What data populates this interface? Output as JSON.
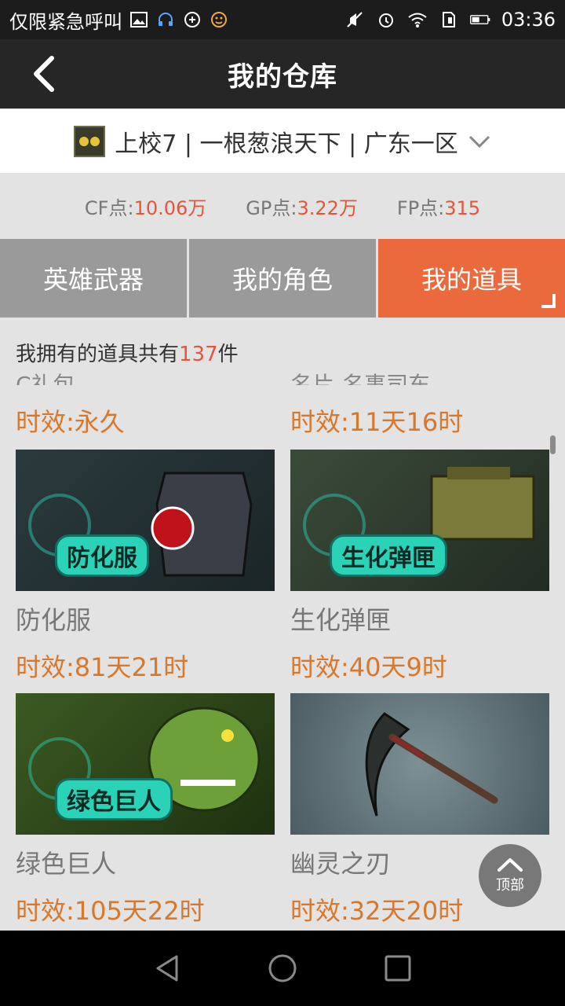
{
  "status_bar": {
    "carrier": "仅限紧急呼叫",
    "time": "03:36",
    "icons": [
      "image-icon",
      "headset-icon",
      "sync-icon",
      "emoji-icon",
      "mute-icon",
      "alarm-icon",
      "wifi-icon",
      "sim-icon",
      "battery-icon"
    ]
  },
  "header": {
    "title": "我的仓库",
    "back_icon": "back-arrow-icon"
  },
  "account": {
    "text": "上校7 | 一根葱浪天下 | 广东一区",
    "dropdown_icon": "chevron-down-icon"
  },
  "points": {
    "cf_label": "CF点:",
    "cf_value": "10.06万",
    "gp_label": "GP点:",
    "gp_value": "3.22万",
    "fp_label": "FP点:",
    "fp_value": "315"
  },
  "tabs": [
    {
      "label": "英雄武器",
      "active": false
    },
    {
      "label": "我的角色",
      "active": false
    },
    {
      "label": "我的道具",
      "active": true
    }
  ],
  "inventory": {
    "count_prefix": "我拥有的道具共有",
    "count": "137",
    "count_suffix": "件",
    "partial_top": [
      {
        "name": "C礼包",
        "expiry": "时效:永久"
      },
      {
        "name": "名片-名事司东",
        "expiry": "时效:11天16时"
      }
    ],
    "items": [
      {
        "name": "防化服",
        "thumb_label": "防化服",
        "expiry": "时效:81天21时",
        "bg": "#2b3a3d"
      },
      {
        "name": "生化弹匣",
        "thumb_label": "生化弹匣",
        "expiry": "时效:40天9时",
        "bg": "#3b4b3a"
      },
      {
        "name": "绿色巨人",
        "thumb_label": "绿色巨人",
        "expiry": "时效:105天22时",
        "bg": "#3c5a22"
      },
      {
        "name": "幽灵之刃",
        "thumb_label": "",
        "expiry": "时效:32天20时",
        "bg": "#5f7277"
      }
    ]
  },
  "top_button": {
    "label": "顶部"
  },
  "colors": {
    "accent": "#ea6a3e",
    "expiry": "#d9772a",
    "value": "#e5553a"
  }
}
